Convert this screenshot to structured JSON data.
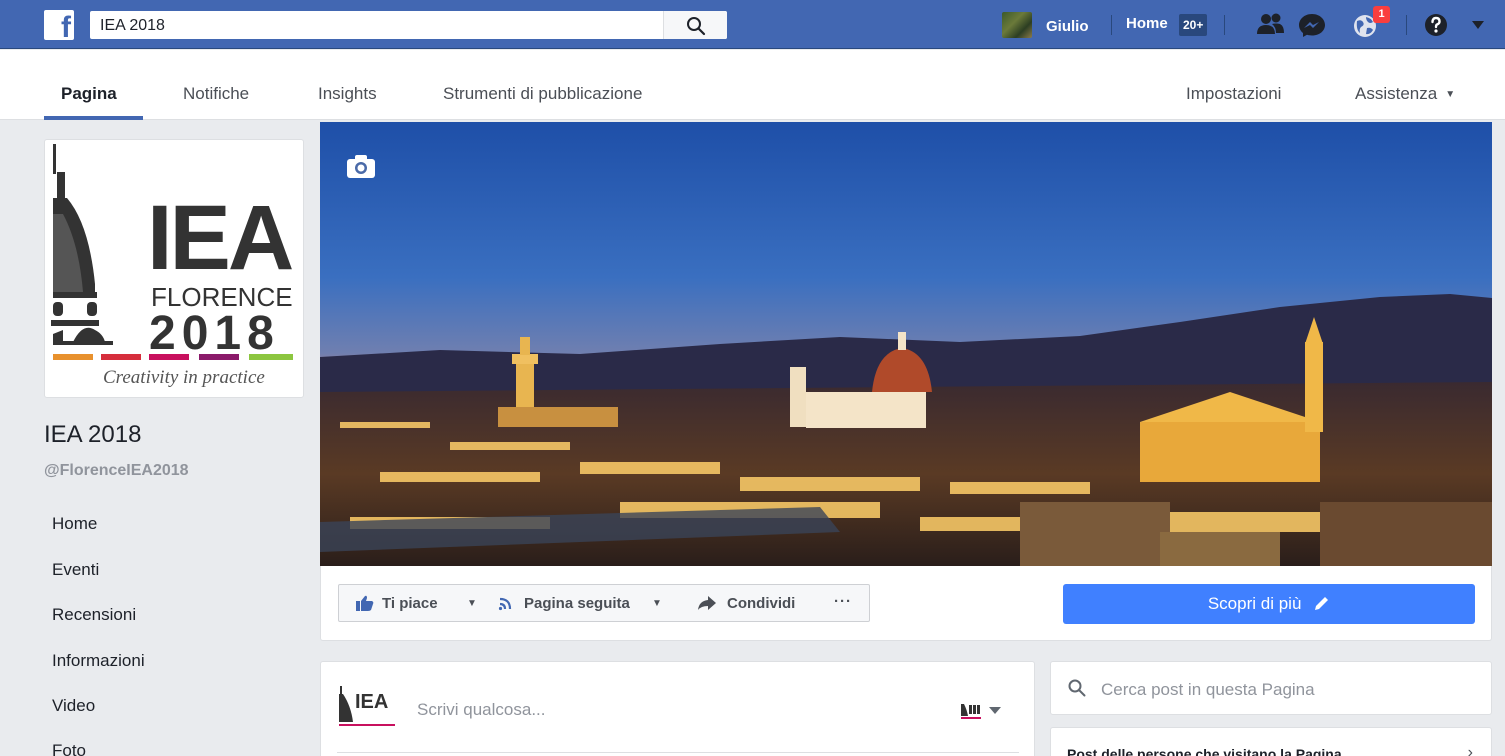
{
  "topbar": {
    "logo": "f",
    "search_value": "IEA 2018",
    "user_name": "Giulio",
    "home_label": "Home",
    "home_count": "20+",
    "notification_count": "1",
    "icons": [
      "friends-icon",
      "messenger-icon",
      "globe-icon",
      "help-icon",
      "caret-down-icon"
    ]
  },
  "pagenav": {
    "tabs": [
      "Pagina",
      "Notifiche",
      "Insights",
      "Strumenti di pubblicazione"
    ],
    "right": [
      "Impostazioni",
      "Assistenza"
    ]
  },
  "profile": {
    "logo_big": "IEA",
    "logo_florence": "FLORENCE",
    "logo_year": "2018",
    "logo_tagline": "Creativity in practice",
    "name": "IEA 2018",
    "handle": "@FlorenceIEA2018"
  },
  "sidebar": {
    "items": [
      "Home",
      "Eventi",
      "Recensioni",
      "Informazioni",
      "Video",
      "Foto"
    ]
  },
  "actions": {
    "like": "Ti piace",
    "follow": "Pagina seguita",
    "share": "Condividi",
    "more": "···",
    "cta": "Scopri di più"
  },
  "composer": {
    "placeholder": "Scrivi qualcosa..."
  },
  "right": {
    "search_placeholder": "Cerca post in questa Pagina",
    "visitors_title": "Post delle persone che visitano la Pagina"
  },
  "colors": {
    "brand": "#4267b2",
    "cta": "#4080ff",
    "badge": "#fa3e3e",
    "logo_stripes": [
      "#e8912d",
      "#d62e3c",
      "#c8105e",
      "#8b1a6a",
      "#8cc63f"
    ]
  }
}
